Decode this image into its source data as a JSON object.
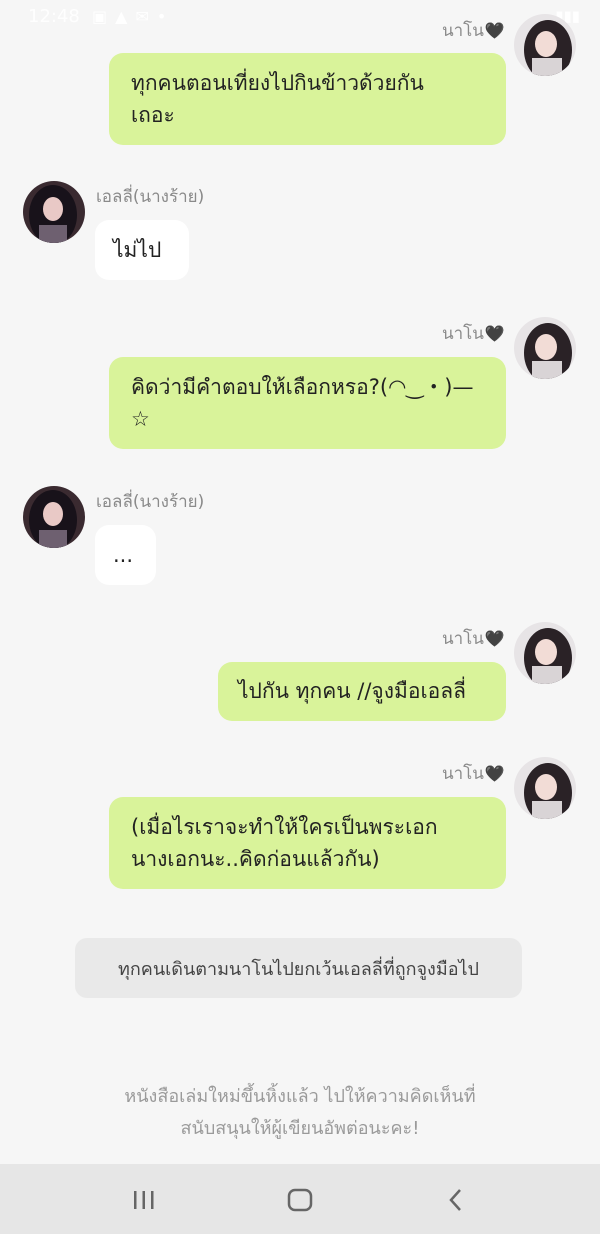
{
  "status_bar": {
    "time": "12:48",
    "icons": [
      "image-icon",
      "notification-icon",
      "mail-icon",
      "more-icon"
    ]
  },
  "messages": [
    {
      "side": "mine",
      "sender": "นาโน",
      "lines": [
        "ทุกคนตอนเที่ยงไปกินข้าวด้วยกัน",
        "เถอะ"
      ]
    },
    {
      "side": "theirs",
      "sender": "เอลลี่(นางร้าย)",
      "lines": [
        "ไม่ไป"
      ]
    },
    {
      "side": "mine",
      "sender": "นาโน",
      "lines": [
        "คิดว่ามีคำตอบให้เลือกหรอ?(◠‿・)—",
        "☆"
      ]
    },
    {
      "side": "theirs",
      "sender": "เอลลี่(นางร้าย)",
      "lines": [
        "..."
      ]
    },
    {
      "side": "mine",
      "sender": "นาโน",
      "lines": [
        "ไปกัน ทุกคน //จูงมือเอลลี่"
      ]
    },
    {
      "side": "mine",
      "sender": "นาโน",
      "lines": [
        "(เมื่อไรเราจะทำให้ใครเป็นพระเอก",
        "นางเอกนะ..คิดก่อนแล้วกัน)"
      ]
    }
  ],
  "narration": "ทุกคนเดินตามนาโนไปยกเว้นเอลลี่ที่ถูกจูงมือไป",
  "footer_note": [
    "หนังสือเล่มใหม่ขึ้นหิ้งแล้ว ไปให้ความคิดเห็นที่",
    "สนับสนุนให้ผู้เขียนอัพต่อนะคะ!"
  ],
  "heart_glyph": "🖤",
  "nav": {
    "recents": "recents-icon",
    "home": "home-icon",
    "back": "back-icon"
  },
  "colors": {
    "background": "#f6f6f6",
    "my_bubble": "#d9f39a",
    "their_bubble": "#ffffff",
    "narration_box": "#e9e9e9",
    "nav_bar": "#e6e6e6"
  }
}
